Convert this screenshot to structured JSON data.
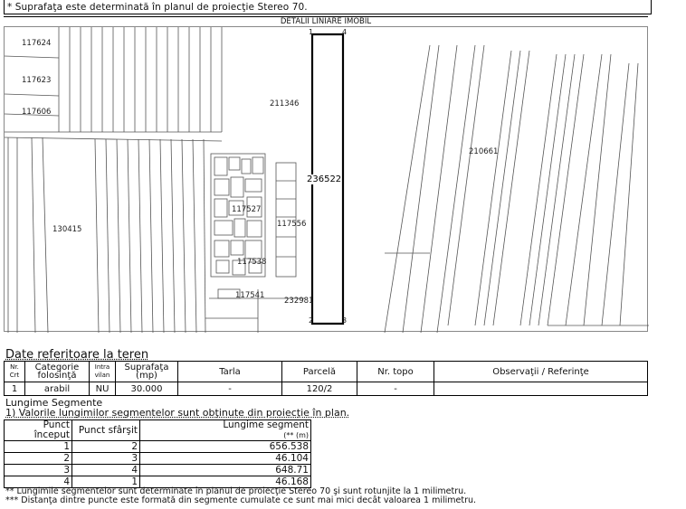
{
  "top_note": "* Suprafaţa este determinată în planul de proiecţie Stereo 70.",
  "map_title": "DETALII LINIARE IMOBIL",
  "map_labels": {
    "p117624": "117624",
    "p117623": "117623",
    "p117606": "117606",
    "p211346": "211346",
    "p210661": "210661",
    "p236522": "236522",
    "p117527": "117527",
    "p117556": "117556",
    "p130415": "130415",
    "p117538": "117538",
    "p117541": "117541",
    "p232981": "232981",
    "pt1": "1",
    "pt2": "2",
    "pt3": "3",
    "pt4": "4"
  },
  "teren": {
    "title": "Date referitoare la teren",
    "headers": [
      "Nr. Crt",
      "Categorie folosinţă",
      "Intra vilan",
      "Suprafaţa (mp)",
      "Tarla",
      "Parcelă",
      "Nr. topo",
      "Observaţii / Referinţe"
    ],
    "row": [
      "1",
      "arabil",
      "NU",
      "30.000",
      "-",
      "120/2",
      "-",
      ""
    ]
  },
  "segmente": {
    "title": "Lungime Segmente",
    "subtitle": "1) Valorile lungimilor segmentelor sunt obţinute din proiecţie în plan.",
    "col_start": "Punct început",
    "col_end": "Punct sfârşit",
    "col_len": "Lungime segment",
    "col_len_unit": "(** (m)",
    "rows": [
      {
        "a": "1",
        "b": "2",
        "len": "656.538"
      },
      {
        "a": "2",
        "b": "3",
        "len": "46.104"
      },
      {
        "a": "3",
        "b": "4",
        "len": "648.71"
      },
      {
        "a": "4",
        "b": "1",
        "len": "46.168"
      }
    ],
    "note1": "** Lungimile segmentelor sunt determinate în planul de proiecţie Stereo 70 şi sunt rotunjite la 1 milimetru.",
    "note2": "*** Distanţa dintre puncte este formată din segmente cumulate ce sunt mai mici decât valoarea 1 milimetru."
  }
}
